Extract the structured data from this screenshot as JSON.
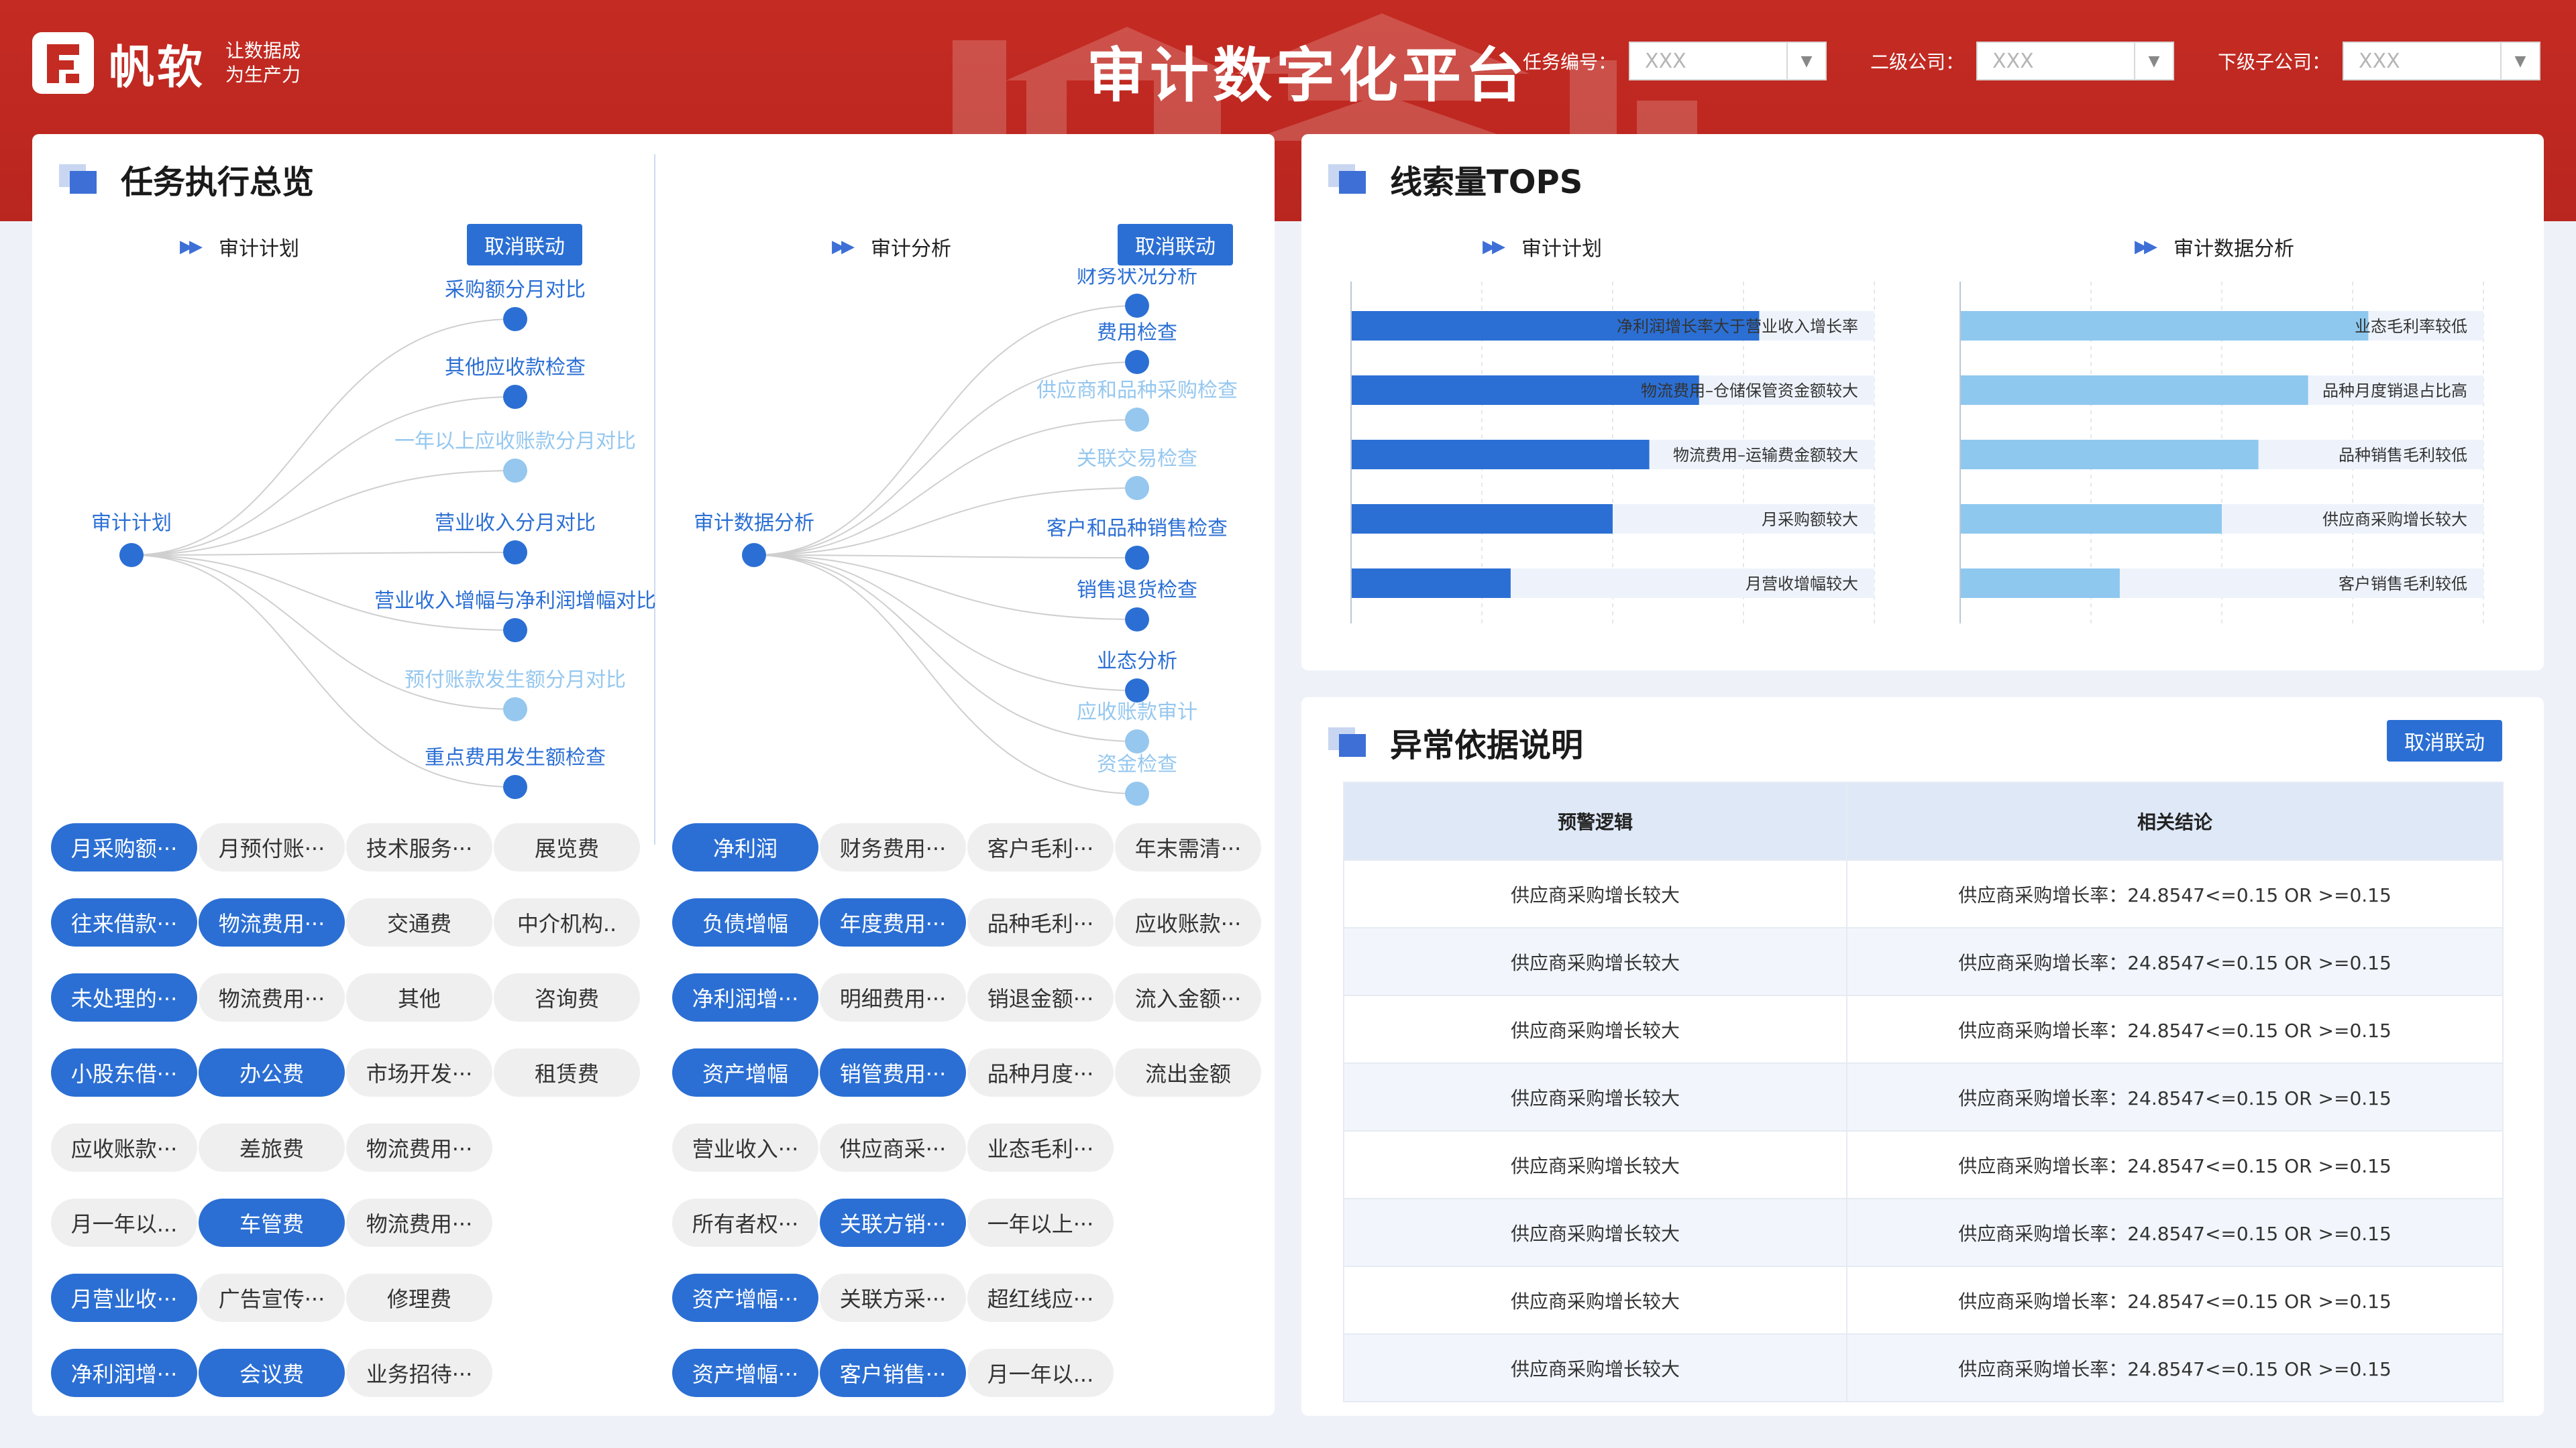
{
  "header": {
    "brand": "帆软",
    "slogan_line1": "让数据成",
    "slogan_line2": "为生产力",
    "title": "审计数字化平台",
    "filters": [
      {
        "label": "任务编号：",
        "value": "XXX"
      },
      {
        "label": "二级公司：",
        "value": "XXX"
      },
      {
        "label": "下级子公司：",
        "value": "XXX"
      }
    ]
  },
  "task_panel": {
    "title": "任务执行总览",
    "left": {
      "subtitle": "审计计划",
      "button": "取消联动",
      "root": "审计计划",
      "nodes": [
        {
          "label": "采购额分月对比",
          "active": true
        },
        {
          "label": "其他应收款检查",
          "active": true
        },
        {
          "label": "一年以上应收账款分月对比",
          "active": false
        },
        {
          "label": "营业收入分月对比",
          "active": true
        },
        {
          "label": "营业收入增幅与净利润增幅对比",
          "active": true
        },
        {
          "label": "预付账款发生额分月对比",
          "active": false
        },
        {
          "label": "重点费用发生额检查",
          "active": true
        }
      ],
      "chips": [
        [
          {
            "t": "月采购额···",
            "on": true
          },
          {
            "t": "月预付账···",
            "on": false
          },
          {
            "t": "技术服务···",
            "on": false
          },
          {
            "t": "展览费",
            "on": false
          }
        ],
        [
          {
            "t": "往来借款···",
            "on": true
          },
          {
            "t": "物流费用···",
            "on": true
          },
          {
            "t": "交通费",
            "on": false
          },
          {
            "t": "中介机构..",
            "on": false
          }
        ],
        [
          {
            "t": "未处理的···",
            "on": true
          },
          {
            "t": "物流费用···",
            "on": false
          },
          {
            "t": "其他",
            "on": false
          },
          {
            "t": "咨询费",
            "on": false
          }
        ],
        [
          {
            "t": "小股东借···",
            "on": true
          },
          {
            "t": "办公费",
            "on": true
          },
          {
            "t": "市场开发···",
            "on": false
          },
          {
            "t": "租赁费",
            "on": false
          }
        ],
        [
          {
            "t": "应收账款···",
            "on": false
          },
          {
            "t": "差旅费",
            "on": false
          },
          {
            "t": "物流费用···",
            "on": false
          }
        ],
        [
          {
            "t": "月一年以...",
            "on": false
          },
          {
            "t": "车管费",
            "on": true
          },
          {
            "t": "物流费用···",
            "on": false
          }
        ],
        [
          {
            "t": "月营业收···",
            "on": true
          },
          {
            "t": "广告宣传···",
            "on": false
          },
          {
            "t": "修理费",
            "on": false
          }
        ],
        [
          {
            "t": "净利润增···",
            "on": true
          },
          {
            "t": "会议费",
            "on": true
          },
          {
            "t": "业务招待···",
            "on": false
          }
        ]
      ]
    },
    "right": {
      "subtitle": "审计分析",
      "button": "取消联动",
      "root": "审计数据分析",
      "nodes": [
        {
          "label": "财务状况分析",
          "active": true
        },
        {
          "label": "费用检查",
          "active": true
        },
        {
          "label": "供应商和品种采购检查",
          "active": false
        },
        {
          "label": "关联交易检查",
          "active": false
        },
        {
          "label": "客户和品种销售检查",
          "active": true
        },
        {
          "label": "销售退货检查",
          "active": true
        },
        {
          "label": "业态分析",
          "active": true
        },
        {
          "label": "应收账款审计",
          "active": false
        },
        {
          "label": "资金检查",
          "active": false
        }
      ],
      "chips": [
        [
          {
            "t": "净利润",
            "on": true
          },
          {
            "t": "财务费用···",
            "on": false
          },
          {
            "t": "客户毛利···",
            "on": false
          },
          {
            "t": "年末需清···",
            "on": false
          }
        ],
        [
          {
            "t": "负债增幅",
            "on": true
          },
          {
            "t": "年度费用···",
            "on": true
          },
          {
            "t": "品种毛利···",
            "on": false
          },
          {
            "t": "应收账款···",
            "on": false
          }
        ],
        [
          {
            "t": "净利润增···",
            "on": true
          },
          {
            "t": "明细费用···",
            "on": false
          },
          {
            "t": "销退金额···",
            "on": false
          },
          {
            "t": "流入金额···",
            "on": false
          }
        ],
        [
          {
            "t": "资产增幅",
            "on": true
          },
          {
            "t": "销管费用···",
            "on": true
          },
          {
            "t": "品种月度···",
            "on": false
          },
          {
            "t": "流出金额",
            "on": false
          }
        ],
        [
          {
            "t": "营业收入···",
            "on": false
          },
          {
            "t": "供应商采···",
            "on": false
          },
          {
            "t": "业态毛利···",
            "on": false
          }
        ],
        [
          {
            "t": "所有者权···",
            "on": false
          },
          {
            "t": "关联方销···",
            "on": true
          },
          {
            "t": "一年以上···",
            "on": false
          }
        ],
        [
          {
            "t": "资产增幅···",
            "on": true
          },
          {
            "t": "关联方采···",
            "on": false
          },
          {
            "t": "超红线应···",
            "on": false
          }
        ],
        [
          {
            "t": "资产增幅···",
            "on": true
          },
          {
            "t": "客户销售···",
            "on": true
          },
          {
            "t": "月一年以...",
            "on": false
          }
        ]
      ]
    }
  },
  "clue_panel": {
    "title": "线索量TOPS",
    "charts": [
      {
        "subtitle": "审计计划",
        "color": "#2b6fd4",
        "bars": [
          {
            "label": "净利润增长率大于营业收入增长率",
            "value": 0.78
          },
          {
            "label": "物流费用–仓储保管资金额较大",
            "value": 0.665
          },
          {
            "label": "物流费用–运输费金额较大",
            "value": 0.57
          },
          {
            "label": "月采购额较大",
            "value": 0.5
          },
          {
            "label": "月营收增幅较大",
            "value": 0.305
          }
        ]
      },
      {
        "subtitle": "审计数据分析",
        "color": "#8ec8ef",
        "bars": [
          {
            "label": "业态毛利率较低",
            "value": 0.78
          },
          {
            "label": "品种月度销退占比高",
            "value": 0.665
          },
          {
            "label": "品种销售毛利较低",
            "value": 0.57
          },
          {
            "label": "供应商采购增长较大",
            "value": 0.5
          },
          {
            "label": "客户销售毛利较低",
            "value": 0.305
          }
        ]
      }
    ]
  },
  "anomaly_panel": {
    "title": "异常依据说明",
    "button": "取消联动",
    "columns": [
      "预警逻辑",
      "相关结论"
    ],
    "rows": [
      [
        "供应商采购增长较大",
        "供应商采购增长率：24.8547<=0.15 OR >=0.15"
      ],
      [
        "供应商采购增长较大",
        "供应商采购增长率：24.8547<=0.15 OR >=0.15"
      ],
      [
        "供应商采购增长较大",
        "供应商采购增长率：24.8547<=0.15 OR >=0.15"
      ],
      [
        "供应商采购增长较大",
        "供应商采购增长率：24.8547<=0.15 OR >=0.15"
      ],
      [
        "供应商采购增长较大",
        "供应商采购增长率：24.8547<=0.15 OR >=0.15"
      ],
      [
        "供应商采购增长较大",
        "供应商采购增长率：24.8547<=0.15 OR >=0.15"
      ],
      [
        "供应商采购增长较大",
        "供应商采购增长率：24.8547<=0.15 OR >=0.15"
      ],
      [
        "供应商采购增长较大",
        "供应商采购增长率：24.8547<=0.15 OR >=0.15"
      ]
    ]
  }
}
